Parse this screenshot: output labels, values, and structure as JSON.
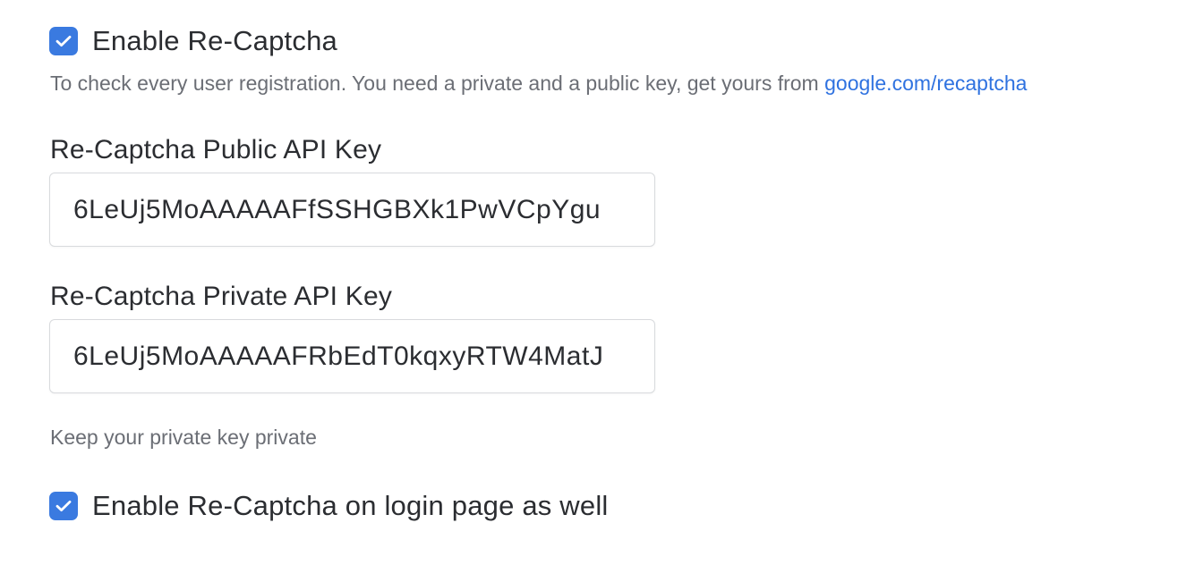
{
  "recaptcha": {
    "enable_label": "Enable Re-Captcha",
    "enable_checked": true,
    "help_text": "To check every user registration. You need a private and a public key, get yours from ",
    "help_link": "google.com/recaptcha",
    "public_key": {
      "label": "Re-Captcha Public API Key",
      "value": "6LeUj5MoAAAAAFfSSHGBXk1PwVCpYgu"
    },
    "private_key": {
      "label": "Re-Captcha Private API Key",
      "value": "6LeUj5MoAAAAAFRbEdT0kqxyRTW4MatJ"
    },
    "private_help": "Keep your private key private",
    "login_label": "Enable Re-Captcha on login page as well",
    "login_checked": true
  },
  "colors": {
    "accent": "#3a7ae0",
    "link": "#2f72e0",
    "muted_text": "#6b6e75",
    "border": "#d8dadd"
  },
  "icons": {
    "checkbox_mark": "checkmark-icon"
  }
}
